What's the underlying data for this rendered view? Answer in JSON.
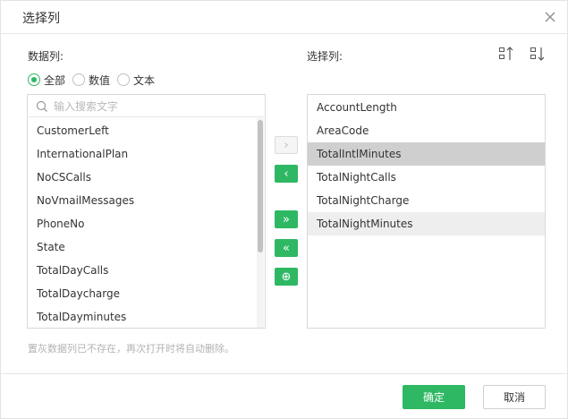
{
  "dialog": {
    "title": "选择列",
    "close_icon": "close-icon"
  },
  "left": {
    "label": "数据列:",
    "filters": [
      {
        "label": "全部",
        "checked": true
      },
      {
        "label": "数值",
        "checked": false
      },
      {
        "label": "文本",
        "checked": false
      }
    ],
    "search_placeholder": "输入搜索文字",
    "items": [
      "CustomerLeft",
      "InternationalPlan",
      "NoCSCalls",
      "NoVmailMessages",
      "PhoneNo",
      "State",
      "TotalDayCalls",
      "TotalDaycharge",
      "TotalDayminutes"
    ]
  },
  "right": {
    "label": "选择列:",
    "sort_icons": [
      "sort-asc-icon",
      "sort-desc-icon"
    ],
    "items": [
      {
        "label": "AccountLength",
        "state": "normal"
      },
      {
        "label": "AreaCode",
        "state": "normal"
      },
      {
        "label": "TotalIntlMinutes",
        "state": "selected"
      },
      {
        "label": "TotalNightCalls",
        "state": "normal"
      },
      {
        "label": "TotalNightCharge",
        "state": "normal"
      },
      {
        "label": "TotalNightMinutes",
        "state": "hover"
      }
    ]
  },
  "transfer_buttons": [
    {
      "name": "move-right-button",
      "glyph": "›",
      "enabled": false
    },
    {
      "name": "move-left-button",
      "glyph": "‹",
      "enabled": true
    },
    {
      "name": "move-all-right-button",
      "glyph": "»",
      "enabled": true
    },
    {
      "name": "move-all-left-button",
      "glyph": "«",
      "enabled": true
    },
    {
      "name": "add-button",
      "glyph": "⊕",
      "enabled": true
    }
  ],
  "hint": "置灰数据列已不存在，再次打开时将自动删除。",
  "footer": {
    "ok_label": "确定",
    "cancel_label": "取消"
  },
  "colors": {
    "accent": "#2eb863",
    "selected_row": "#cfcfcf",
    "hover_row": "#eeeeee"
  }
}
